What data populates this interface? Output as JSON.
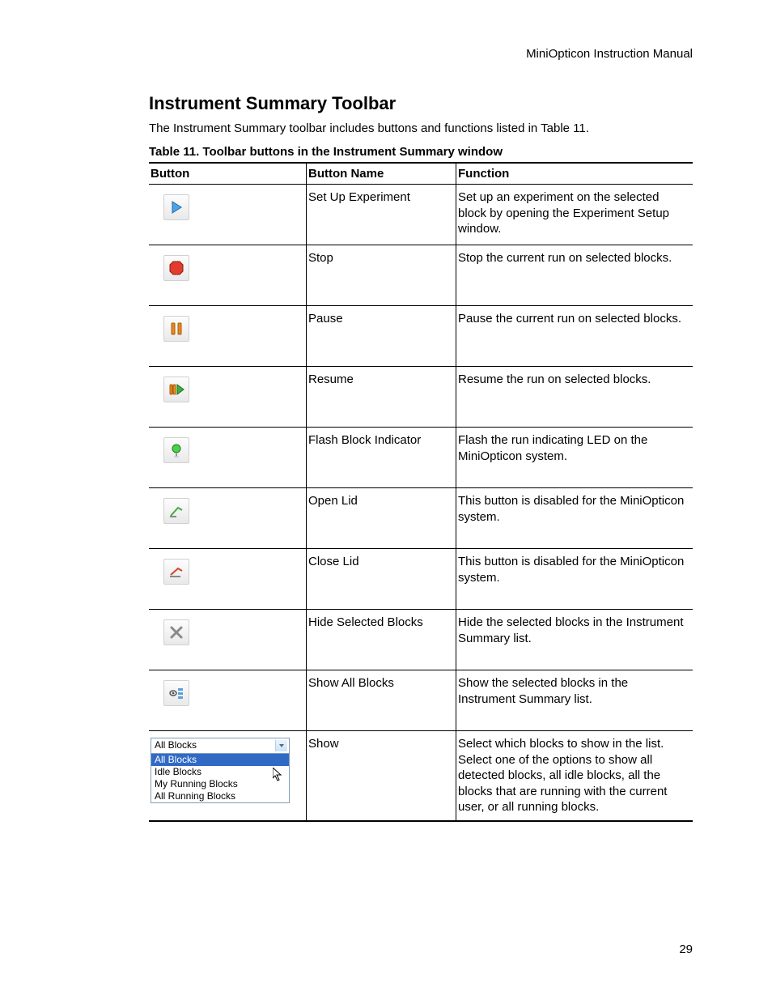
{
  "header": {
    "running_head": "MiniOpticon Instruction Manual"
  },
  "section": {
    "title": "Instrument Summary Toolbar",
    "intro": "The Instrument Summary toolbar includes buttons and functions listed in Table 11.",
    "table_caption": "Table 11. Toolbar buttons in the Instrument Summary window"
  },
  "table": {
    "columns": {
      "button": "Button",
      "name": "Button Name",
      "function": "Function"
    },
    "rows": [
      {
        "icon": "play-icon",
        "name": "Set Up Experiment",
        "function": "Set up an experiment on the selected block by opening the Experiment Setup window."
      },
      {
        "icon": "stop-icon",
        "name": "Stop",
        "function": "Stop the current run on selected blocks."
      },
      {
        "icon": "pause-icon",
        "name": "Pause",
        "function": "Pause the current run on selected blocks."
      },
      {
        "icon": "resume-icon",
        "name": "Resume",
        "function": "Resume the run on selected blocks."
      },
      {
        "icon": "flash-indicator-icon",
        "name": "Flash Block Indicator",
        "function": "Flash the run indicating LED on the MiniOpticon system."
      },
      {
        "icon": "open-lid-icon",
        "name": "Open Lid",
        "function": "This button is disabled for the MiniOpticon system."
      },
      {
        "icon": "close-lid-icon",
        "name": "Close Lid",
        "function": "This button is disabled for the MiniOpticon system."
      },
      {
        "icon": "hide-blocks-icon",
        "name": "Hide Selected Blocks",
        "function": "Hide the selected blocks in the Instrument Summary list."
      },
      {
        "icon": "show-all-blocks-icon",
        "name": "Show All Blocks",
        "function": "Show the selected blocks in the Instrument Summary list."
      },
      {
        "icon": "show-dropdown",
        "name": "Show",
        "function": "Select which blocks to show in the list. Select one of the options to show all detected blocks, all idle blocks, all the blocks that are running with the current user, or all running blocks."
      }
    ]
  },
  "dropdown": {
    "selected": "All Blocks",
    "options": [
      "All Blocks",
      "Idle Blocks",
      "My Running Blocks",
      "All Running Blocks"
    ],
    "highlight_index": 0
  },
  "footer": {
    "page_number": "29"
  }
}
